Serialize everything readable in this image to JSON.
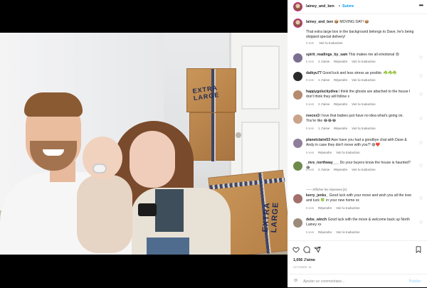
{
  "post": {
    "username": "lainey_and_ben",
    "follow_label": "Suivre",
    "dot": "•",
    "more_label": "•••"
  },
  "caption": {
    "username": "lainey_and_ben",
    "text1": "📦 MOVING DAY! 📦",
    "text2": "That extra large box in the background belongs to Dave, he's being shipped special delivery!",
    "time": "5 sem",
    "translate": "Voir la traduction"
  },
  "photo": {
    "box1_label": "EXTRA LARGE",
    "box3_label": "EXTRA LARGE"
  },
  "comments": [
    {
      "username": "spirit_readings_by_sam",
      "text": "This makes me all emotional 😢",
      "time": "5 sem",
      "likes": "2 J'aime",
      "reply": "Répondre",
      "translate": "Voir la traduction",
      "avatar_color": "#7b6f91"
    },
    {
      "username": "daikyu77",
      "text": "Good luck and less stress as posible. ☘️☘️☘️",
      "time": "5 sem",
      "likes": "1 J'aime",
      "reply": "Répondre",
      "translate": "Voir la traduction",
      "avatar_color": "#2b2b2b"
    },
    {
      "username": "happygoluckydiva",
      "text": "I think the ghosts are attached to the house I don't think they will follow x",
      "time": "5 sem",
      "likes": "2 J'aime",
      "reply": "Répondre",
      "translate": "Voir la traduction",
      "avatar_color": "#b58a6e"
    },
    {
      "username": "reecex3",
      "text": "I love that babies just have no idea what's going on. You're like 😂😂😂",
      "time": "5 sem",
      "likes": "1 J'aime",
      "reply": "Répondre",
      "translate": "Voir la traduction",
      "avatar_color": "#c9a48a"
    },
    {
      "username": "planetclaire53",
      "text": "Awe have you had a goodbye chat with Dave & Andy in case they don't move with you!? 😆❤️",
      "time": "5 sem",
      "likes": "",
      "reply": "Répondre",
      "translate": "Voir la traduction",
      "avatar_color": "#8f7d9a"
    },
    {
      "username": "_mrs_northway___",
      "text": "Do your buyers know the house is haunted? 😂",
      "time": "5 sem",
      "likes": "2 J'aime",
      "reply": "Répondre",
      "translate": "Voir la traduction",
      "avatar_color": "#6d8a4a"
    },
    {
      "username": "kerry_jenks_",
      "text": "Good luck with your move and wish you all the love and luck 🍀 in your new home xx",
      "time": "5 sem",
      "likes": "",
      "reply": "Répondre",
      "translate": "Voir la traduction",
      "avatar_color": "#a2706a"
    },
    {
      "username": "debs_winch",
      "text": "Good luck with the move & welcome back up North Lainey xx",
      "time": "5 sem",
      "likes": "",
      "reply": "Répondre",
      "translate": "Voir la traduction",
      "avatar_color": "#9c8b7a"
    }
  ],
  "view_replies": "—— Afficher les réponses (2)",
  "actions": {
    "likes": "1,056 J'aime",
    "date": "OCTOBRE 18",
    "add_comment_placeholder": "Ajouter un commentaire...",
    "post_label": "Publier",
    "like_icon": "heart-outline-icon",
    "comment_icon": "comment-bubble-icon",
    "share_icon": "paper-plane-icon",
    "save_icon": "bookmark-icon",
    "emoji_icon": "smiley-icon"
  },
  "colors": {
    "link_blue": "#0095f6",
    "meta_gray": "#8e8e8e",
    "text": "#262626"
  }
}
